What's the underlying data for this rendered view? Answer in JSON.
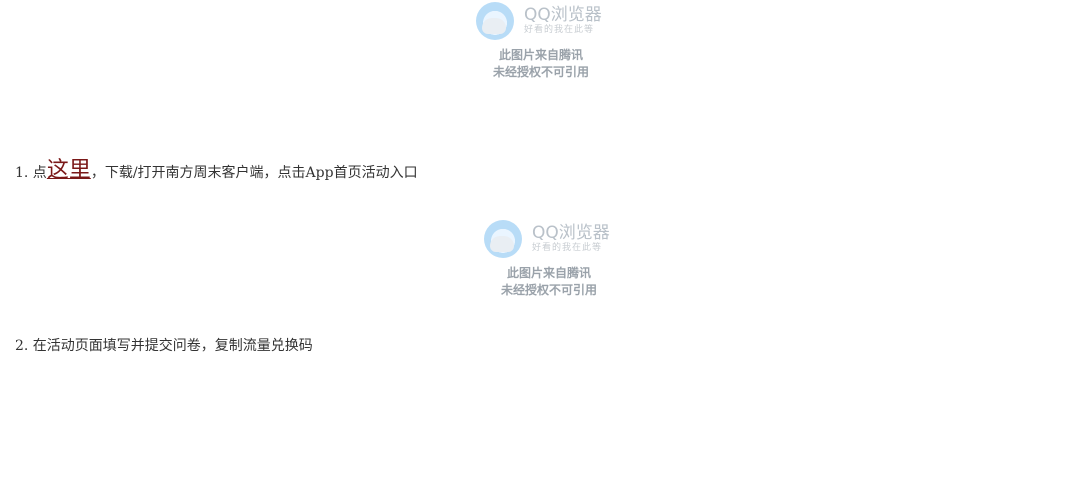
{
  "image_placeholder": {
    "brand": "QQ浏览器",
    "slogan": "好看的我在此等",
    "line1": "此图片来自腾讯",
    "line2": "未经授权不可引用"
  },
  "steps": [
    {
      "prefix": "1. 点",
      "link_text": "这里",
      "suffix": "，下载/打开南方周末客户端，点击App首页活动入口"
    },
    {
      "text": "2. 在活动页面填写并提交问卷，复制流量兑换码"
    }
  ]
}
